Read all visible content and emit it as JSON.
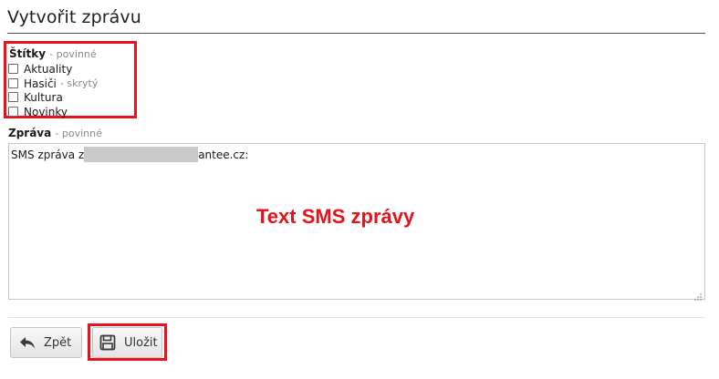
{
  "header": {
    "title": "Vytvořit zprávu"
  },
  "tags": {
    "label": "Štítky",
    "required_note": "- povinné",
    "items": [
      {
        "label": "Aktuality",
        "checked": false,
        "note": ""
      },
      {
        "label": "Hasiči",
        "checked": false,
        "note": "- skrytý"
      },
      {
        "label": "Kultura",
        "checked": false,
        "note": ""
      },
      {
        "label": "Novinky",
        "checked": false,
        "note": ""
      }
    ]
  },
  "message": {
    "label": "Zpráva",
    "required_note": "- povinné",
    "text_prefix": "SMS zpráva z",
    "text_suffix": "antee.cz:",
    "annotation": "Text SMS zprávy"
  },
  "actions": {
    "back_label": "Zpět",
    "save_label": "Uložit"
  },
  "colors": {
    "highlight": "#e8121b",
    "required_note": "#8a8a8a",
    "title_rule": "#4a5a4a"
  },
  "icons": {
    "back": "undo-arrow-icon",
    "save": "floppy-disk-icon",
    "resize": "resize-grip-icon"
  }
}
